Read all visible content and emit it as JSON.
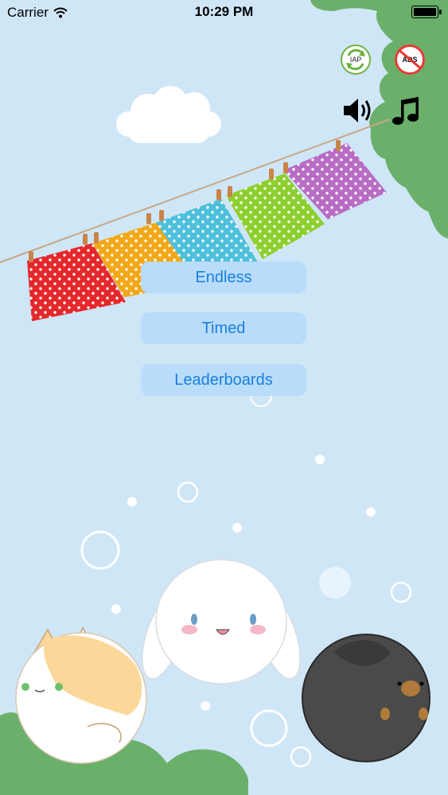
{
  "status_bar": {
    "carrier": "Carrier",
    "time": "10:29 PM"
  },
  "top_buttons": {
    "iap_label": "IAP",
    "no_ads_label": "ADS"
  },
  "menu": {
    "endless": "Endless",
    "timed": "Timed",
    "leaderboards": "Leaderboards"
  },
  "icons": {
    "sound": "speaker-icon",
    "music": "music-note-icon"
  },
  "colors": {
    "sky": "#cfe6f7",
    "tree": "#6ab06a",
    "button_bg": "#b8dcfa",
    "button_text": "#1a7fe0",
    "cloth_red": "#e4282c",
    "cloth_orange": "#f2a818",
    "cloth_cyan": "#4ec0dc",
    "cloth_green": "#8ccf2e",
    "cloth_purple": "#b86cc4"
  }
}
